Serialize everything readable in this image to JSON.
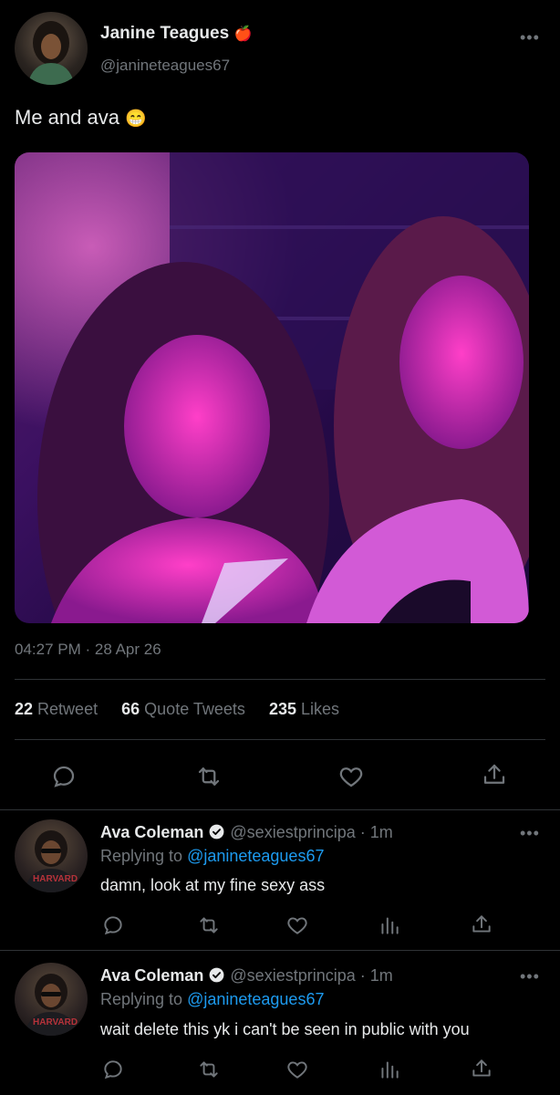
{
  "tweet": {
    "author_name": "Janine Teagues",
    "author_emoji": "🍎",
    "author_handle": "@janineteagues67",
    "text": "Me and ava",
    "text_emoji": "😁",
    "timestamp": "04:27 PM · 28 Apr 26",
    "more_label": "•••",
    "stats": {
      "retweets_count": "22",
      "retweets_label": "Retweet",
      "quotes_count": "66",
      "quotes_label": "Quote Tweets",
      "likes_count": "235",
      "likes_label": "Likes"
    },
    "actions": [
      "reply-icon",
      "retweet-icon",
      "like-icon",
      "share-icon"
    ]
  },
  "replies": [
    {
      "author_name": "Ava Coleman",
      "author_handle": "@sexiestprincipa",
      "time": "· 1m",
      "replying_prefix": "Replying to",
      "replying_to": "@janineteagues67",
      "text": "damn, look at my fine sexy ass",
      "avatar_shirt_text": "HARVARD",
      "more_label": "•••"
    },
    {
      "author_name": "Ava Coleman",
      "author_handle": "@sexiestprincipa",
      "time": "· 1m",
      "replying_prefix": "Replying to",
      "replying_to": "@janineteagues67",
      "text": "wait delete this yk i can't be seen in public with you",
      "avatar_shirt_text": "HARVARD",
      "more_label": "•••"
    }
  ],
  "colors": {
    "background": "#000000",
    "text": "#e7e9ea",
    "muted": "#71767b",
    "accent": "#1d9bf0",
    "divider": "#2f3336"
  }
}
